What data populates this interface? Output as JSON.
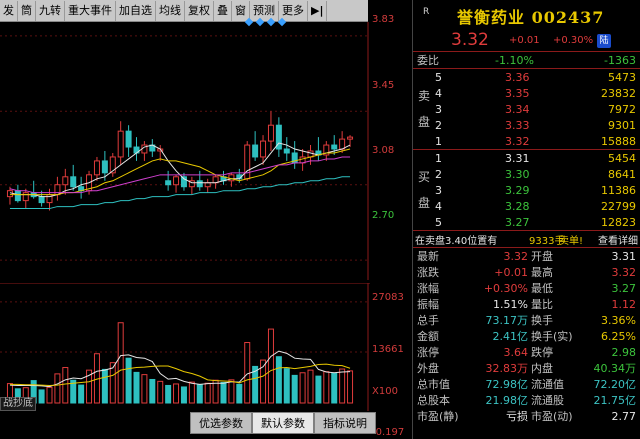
{
  "toolbar": {
    "items": [
      "发",
      "筒",
      "九转",
      "重大事件",
      "加自选",
      "均线",
      "复权",
      "叠",
      "窗",
      "预测",
      "更多"
    ],
    "arrow": "▶|"
  },
  "price_axis": [
    "3.83",
    "3.45",
    "3.08",
    "2.70"
  ],
  "volume_axis": [
    "27083",
    "13661",
    "X100",
    "-0.197"
  ],
  "corner_label": "战抄底",
  "bottom_tabs": [
    "优选参数",
    "默认参数",
    "指标说明"
  ],
  "header": {
    "marker": "R",
    "title": "誉衡药业 002437",
    "price": "3.32",
    "change": "+0.01",
    "pct": "+0.30%",
    "badge": "陆"
  },
  "weibi": {
    "label": "委比",
    "pct": "-1.10%",
    "diff": "-1363"
  },
  "asks": {
    "side_label": [
      "卖",
      "盘"
    ],
    "rows": [
      {
        "level": "5",
        "price": "3.36",
        "vol": "5473"
      },
      {
        "level": "4",
        "price": "3.35",
        "vol": "23832"
      },
      {
        "level": "3",
        "price": "3.34",
        "vol": "7972"
      },
      {
        "level": "2",
        "price": "3.33",
        "vol": "9301"
      },
      {
        "level": "1",
        "price": "3.32",
        "vol": "15888"
      }
    ]
  },
  "bids": {
    "side_label": [
      "买",
      "盘"
    ],
    "rows": [
      {
        "level": "1",
        "price": "3.31",
        "vol": "5454"
      },
      {
        "level": "2",
        "price": "3.30",
        "vol": "8641"
      },
      {
        "level": "3",
        "price": "3.29",
        "vol": "11386"
      },
      {
        "level": "4",
        "price": "3.28",
        "vol": "22799"
      },
      {
        "level": "5",
        "price": "3.27",
        "vol": "12823"
      }
    ]
  },
  "tip": {
    "text": "在卖盘3.40位置有",
    "vol": "9333手",
    "action": "卖单!",
    "detail": "查看详细"
  },
  "stats": [
    {
      "l1": "最新",
      "v1": "3.32",
      "c1": "red",
      "l2": "开盘",
      "v2": "3.31",
      "c2": "white"
    },
    {
      "l1": "涨跌",
      "v1": "+0.01",
      "c1": "red",
      "l2": "最高",
      "v2": "3.32",
      "c2": "red"
    },
    {
      "l1": "涨幅",
      "v1": "+0.30%",
      "c1": "red",
      "l2": "最低",
      "v2": "3.27",
      "c2": "green"
    },
    {
      "l1": "振幅",
      "v1": "1.51%",
      "c1": "white",
      "l2": "量比",
      "v2": "1.12",
      "c2": "red"
    },
    {
      "l1": "总手",
      "v1": "73.17万",
      "c1": "cyan",
      "l2": "换手",
      "v2": "3.36%",
      "c2": "yellow"
    },
    {
      "l1": "金额",
      "v1": "2.41亿",
      "c1": "cyan",
      "l2": "换手(实)",
      "v2": "6.25%",
      "c2": "yellow"
    },
    {
      "l1": "涨停",
      "v1": "3.64",
      "c1": "red",
      "l2": "跌停",
      "v2": "2.98",
      "c2": "green"
    },
    {
      "l1": "外盘",
      "v1": "32.83万",
      "c1": "red",
      "l2": "内盘",
      "v2": "40.34万",
      "c2": "green"
    },
    {
      "l1": "总市值",
      "v1": "72.98亿",
      "c1": "cyan",
      "l2": "流通值",
      "v2": "72.20亿",
      "c2": "cyan"
    },
    {
      "l1": "总股本",
      "v1": "21.98亿",
      "c1": "cyan",
      "l2": "流通股",
      "v2": "21.75亿",
      "c2": "cyan"
    },
    {
      "l1": "市盈(静)",
      "v1": "亏损",
      "c1": "white",
      "l2": "市盈(动)",
      "v2": "2.77",
      "c2": "white"
    }
  ],
  "chart_data": {
    "type": "candlestick",
    "price_range": [
      2.6,
      3.9
    ],
    "candles": [
      {
        "o": 3.02,
        "h": 3.07,
        "l": 2.98,
        "c": 3.05
      },
      {
        "o": 3.05,
        "h": 3.08,
        "l": 2.99,
        "c": 3.0
      },
      {
        "o": 3.0,
        "h": 3.06,
        "l": 2.96,
        "c": 3.04
      },
      {
        "o": 3.04,
        "h": 3.1,
        "l": 3.01,
        "c": 3.02
      },
      {
        "o": 3.02,
        "h": 3.05,
        "l": 2.97,
        "c": 2.99
      },
      {
        "o": 2.99,
        "h": 3.06,
        "l": 2.95,
        "c": 3.03
      },
      {
        "o": 3.03,
        "h": 3.12,
        "l": 3.0,
        "c": 3.08
      },
      {
        "o": 3.08,
        "h": 3.16,
        "l": 3.03,
        "c": 3.12
      },
      {
        "o": 3.12,
        "h": 3.18,
        "l": 3.05,
        "c": 3.07
      },
      {
        "o": 3.07,
        "h": 3.12,
        "l": 3.01,
        "c": 3.05
      },
      {
        "o": 3.05,
        "h": 3.15,
        "l": 3.03,
        "c": 3.13
      },
      {
        "o": 3.13,
        "h": 3.22,
        "l": 3.1,
        "c": 3.2
      },
      {
        "o": 3.2,
        "h": 3.25,
        "l": 3.1,
        "c": 3.14
      },
      {
        "o": 3.14,
        "h": 3.24,
        "l": 3.12,
        "c": 3.22
      },
      {
        "o": 3.22,
        "h": 3.4,
        "l": 3.18,
        "c": 3.35
      },
      {
        "o": 3.35,
        "h": 3.38,
        "l": 3.22,
        "c": 3.27
      },
      {
        "o": 3.27,
        "h": 3.32,
        "l": 3.2,
        "c": 3.24
      },
      {
        "o": 3.24,
        "h": 3.3,
        "l": 3.2,
        "c": 3.28
      },
      {
        "o": 3.28,
        "h": 3.31,
        "l": 3.22,
        "c": 3.25
      },
      {
        "o": 3.25,
        "h": 3.28,
        "l": 3.2,
        "c": 3.26
      },
      {
        "o": 3.1,
        "h": 3.15,
        "l": 3.05,
        "c": 3.08
      },
      {
        "o": 3.08,
        "h": 3.13,
        "l": 3.04,
        "c": 3.12
      },
      {
        "o": 3.12,
        "h": 3.14,
        "l": 3.05,
        "c": 3.07
      },
      {
        "o": 3.07,
        "h": 3.12,
        "l": 3.03,
        "c": 3.1
      },
      {
        "o": 3.1,
        "h": 3.15,
        "l": 3.05,
        "c": 3.07
      },
      {
        "o": 3.07,
        "h": 3.11,
        "l": 3.04,
        "c": 3.09
      },
      {
        "o": 3.09,
        "h": 3.13,
        "l": 3.06,
        "c": 3.12
      },
      {
        "o": 3.12,
        "h": 3.15,
        "l": 3.08,
        "c": 3.1
      },
      {
        "o": 3.1,
        "h": 3.14,
        "l": 3.07,
        "c": 3.13
      },
      {
        "o": 3.13,
        "h": 3.16,
        "l": 3.09,
        "c": 3.11
      },
      {
        "o": 3.11,
        "h": 3.3,
        "l": 3.1,
        "c": 3.28
      },
      {
        "o": 3.28,
        "h": 3.35,
        "l": 3.2,
        "c": 3.22
      },
      {
        "o": 3.22,
        "h": 3.33,
        "l": 3.18,
        "c": 3.3
      },
      {
        "o": 3.3,
        "h": 3.45,
        "l": 3.25,
        "c": 3.38
      },
      {
        "o": 3.38,
        "h": 3.42,
        "l": 3.22,
        "c": 3.26
      },
      {
        "o": 3.26,
        "h": 3.32,
        "l": 3.2,
        "c": 3.24
      },
      {
        "o": 3.24,
        "h": 3.3,
        "l": 3.16,
        "c": 3.19
      },
      {
        "o": 3.19,
        "h": 3.26,
        "l": 3.15,
        "c": 3.22
      },
      {
        "o": 3.22,
        "h": 3.28,
        "l": 3.18,
        "c": 3.25
      },
      {
        "o": 3.25,
        "h": 3.32,
        "l": 3.2,
        "c": 3.23
      },
      {
        "o": 3.23,
        "h": 3.3,
        "l": 3.2,
        "c": 3.28
      },
      {
        "o": 3.28,
        "h": 3.33,
        "l": 3.23,
        "c": 3.26
      },
      {
        "o": 3.26,
        "h": 3.35,
        "l": 3.24,
        "c": 3.31
      },
      {
        "o": 3.31,
        "h": 3.33,
        "l": 3.27,
        "c": 3.32
      }
    ],
    "ma_lines": [
      {
        "name": "MA5",
        "color": "#e6e6e6",
        "values": [
          3.04,
          3.03,
          3.03,
          3.03,
          3.02,
          3.02,
          3.03,
          3.05,
          3.06,
          3.08,
          3.09,
          3.11,
          3.12,
          3.15,
          3.18,
          3.21,
          3.24,
          3.27,
          3.28,
          3.26,
          3.2,
          3.15,
          3.11,
          3.09,
          3.09,
          3.09,
          3.09,
          3.1,
          3.11,
          3.11,
          3.15,
          3.17,
          3.19,
          3.24,
          3.29,
          3.28,
          3.26,
          3.25,
          3.24,
          3.23,
          3.24,
          3.25,
          3.26,
          3.28
        ]
      },
      {
        "name": "MA10",
        "color": "#e8c800",
        "values": [
          3.03,
          3.03,
          3.03,
          3.03,
          3.03,
          3.03,
          3.03,
          3.04,
          3.04,
          3.05,
          3.06,
          3.07,
          3.09,
          3.1,
          3.12,
          3.14,
          3.16,
          3.18,
          3.2,
          3.21,
          3.2,
          3.2,
          3.19,
          3.18,
          3.17,
          3.15,
          3.13,
          3.12,
          3.11,
          3.1,
          3.11,
          3.12,
          3.13,
          3.15,
          3.18,
          3.19,
          3.2,
          3.21,
          3.22,
          3.23,
          3.24,
          3.24,
          3.25,
          3.26
        ]
      },
      {
        "name": "MA20",
        "color": "#d040d0",
        "values": [
          3.06,
          3.05,
          3.05,
          3.04,
          3.04,
          3.04,
          3.04,
          3.04,
          3.04,
          3.04,
          3.05,
          3.05,
          3.06,
          3.07,
          3.08,
          3.09,
          3.1,
          3.11,
          3.12,
          3.13,
          3.13,
          3.13,
          3.13,
          3.13,
          3.13,
          3.13,
          3.13,
          3.13,
          3.14,
          3.14,
          3.14,
          3.15,
          3.16,
          3.17,
          3.18,
          3.18,
          3.19,
          3.19,
          3.2,
          3.2,
          3.21,
          3.21,
          3.22,
          3.22
        ]
      },
      {
        "name": "MA60",
        "color": "#2ec0c0",
        "values": [
          2.96,
          2.96,
          2.96,
          2.96,
          2.96,
          2.96,
          2.97,
          2.97,
          2.97,
          2.98,
          2.98,
          2.98,
          2.99,
          2.99,
          3.0,
          3.0,
          3.01,
          3.01,
          3.02,
          3.02,
          3.02,
          3.03,
          3.03,
          3.03,
          3.04,
          3.04,
          3.04,
          3.05,
          3.05,
          3.05,
          3.06,
          3.06,
          3.07,
          3.07,
          3.08,
          3.08,
          3.09,
          3.09,
          3.1,
          3.1,
          3.11,
          3.11,
          3.12,
          3.12
        ]
      }
    ],
    "volume_range": [
      0,
      30000
    ],
    "volumes": [
      5200,
      3800,
      4100,
      6000,
      3500,
      4200,
      7800,
      9500,
      6100,
      4800,
      8800,
      13200,
      9000,
      10800,
      21500,
      12000,
      8200,
      7600,
      6300,
      5800,
      4700,
      5100,
      4300,
      5600,
      4900,
      5300,
      6100,
      5500,
      6200,
      5000,
      16200,
      9800,
      11500,
      19800,
      12400,
      9200,
      7400,
      8100,
      8800,
      7200,
      8400,
      7900,
      9100,
      8600
    ],
    "vol_ma": [
      {
        "name": "MAVOL5",
        "color": "#e6e6e6",
        "values": [
          4800,
          4700,
          4700,
          4700,
          4600,
          4400,
          5100,
          6200,
          6700,
          6500,
          7400,
          8500,
          8800,
          9400,
          12700,
          12900,
          12200,
          12000,
          11100,
          7900,
          6400,
          6600,
          5800,
          5300,
          5000,
          5200,
          5300,
          5300,
          5700,
          5600,
          7800,
          8500,
          9700,
          12500,
          13900,
          13300,
          12000,
          11800,
          11700,
          9000,
          8300,
          8100,
          8300,
          8400
        ]
      },
      {
        "name": "MAVOL10",
        "color": "#e8c800",
        "values": [
          5000,
          5000,
          4900,
          4900,
          4800,
          4700,
          4800,
          5100,
          5300,
          5500,
          5700,
          6400,
          6900,
          7400,
          8800,
          9200,
          9500,
          9600,
          9800,
          9900,
          9900,
          9200,
          8400,
          7900,
          7200,
          6200,
          6000,
          5900,
          5800,
          5400,
          6200,
          6600,
          7200,
          8700,
          9400,
          9500,
          9200,
          9500,
          9800,
          10300,
          10400,
          10100,
          10000,
          9300
        ]
      }
    ]
  }
}
